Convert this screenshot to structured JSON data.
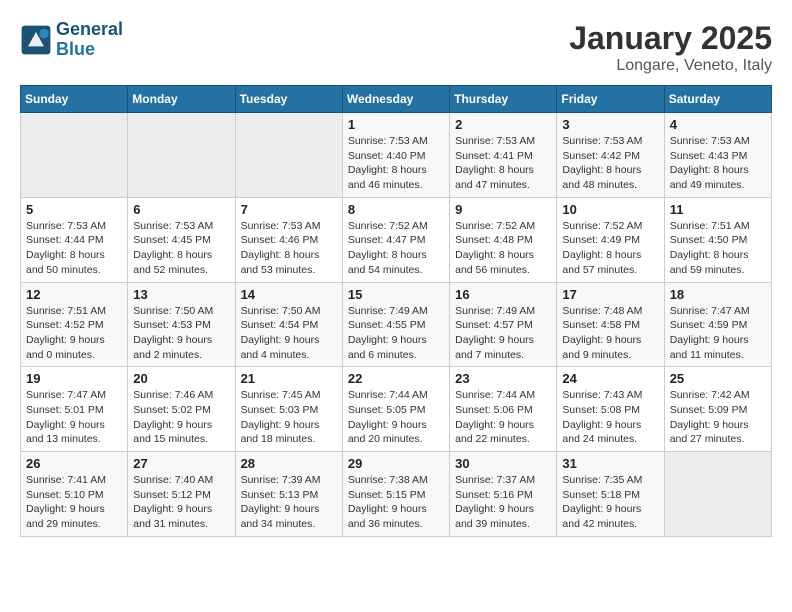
{
  "header": {
    "logo_line1": "General",
    "logo_line2": "Blue",
    "title": "January 2025",
    "subtitle": "Longare, Veneto, Italy"
  },
  "weekdays": [
    "Sunday",
    "Monday",
    "Tuesday",
    "Wednesday",
    "Thursday",
    "Friday",
    "Saturday"
  ],
  "weeks": [
    [
      {
        "day": "",
        "info": ""
      },
      {
        "day": "",
        "info": ""
      },
      {
        "day": "",
        "info": ""
      },
      {
        "day": "1",
        "info": "Sunrise: 7:53 AM\nSunset: 4:40 PM\nDaylight: 8 hours and 46 minutes."
      },
      {
        "day": "2",
        "info": "Sunrise: 7:53 AM\nSunset: 4:41 PM\nDaylight: 8 hours and 47 minutes."
      },
      {
        "day": "3",
        "info": "Sunrise: 7:53 AM\nSunset: 4:42 PM\nDaylight: 8 hours and 48 minutes."
      },
      {
        "day": "4",
        "info": "Sunrise: 7:53 AM\nSunset: 4:43 PM\nDaylight: 8 hours and 49 minutes."
      }
    ],
    [
      {
        "day": "5",
        "info": "Sunrise: 7:53 AM\nSunset: 4:44 PM\nDaylight: 8 hours and 50 minutes."
      },
      {
        "day": "6",
        "info": "Sunrise: 7:53 AM\nSunset: 4:45 PM\nDaylight: 8 hours and 52 minutes."
      },
      {
        "day": "7",
        "info": "Sunrise: 7:53 AM\nSunset: 4:46 PM\nDaylight: 8 hours and 53 minutes."
      },
      {
        "day": "8",
        "info": "Sunrise: 7:52 AM\nSunset: 4:47 PM\nDaylight: 8 hours and 54 minutes."
      },
      {
        "day": "9",
        "info": "Sunrise: 7:52 AM\nSunset: 4:48 PM\nDaylight: 8 hours and 56 minutes."
      },
      {
        "day": "10",
        "info": "Sunrise: 7:52 AM\nSunset: 4:49 PM\nDaylight: 8 hours and 57 minutes."
      },
      {
        "day": "11",
        "info": "Sunrise: 7:51 AM\nSunset: 4:50 PM\nDaylight: 8 hours and 59 minutes."
      }
    ],
    [
      {
        "day": "12",
        "info": "Sunrise: 7:51 AM\nSunset: 4:52 PM\nDaylight: 9 hours and 0 minutes."
      },
      {
        "day": "13",
        "info": "Sunrise: 7:50 AM\nSunset: 4:53 PM\nDaylight: 9 hours and 2 minutes."
      },
      {
        "day": "14",
        "info": "Sunrise: 7:50 AM\nSunset: 4:54 PM\nDaylight: 9 hours and 4 minutes."
      },
      {
        "day": "15",
        "info": "Sunrise: 7:49 AM\nSunset: 4:55 PM\nDaylight: 9 hours and 6 minutes."
      },
      {
        "day": "16",
        "info": "Sunrise: 7:49 AM\nSunset: 4:57 PM\nDaylight: 9 hours and 7 minutes."
      },
      {
        "day": "17",
        "info": "Sunrise: 7:48 AM\nSunset: 4:58 PM\nDaylight: 9 hours and 9 minutes."
      },
      {
        "day": "18",
        "info": "Sunrise: 7:47 AM\nSunset: 4:59 PM\nDaylight: 9 hours and 11 minutes."
      }
    ],
    [
      {
        "day": "19",
        "info": "Sunrise: 7:47 AM\nSunset: 5:01 PM\nDaylight: 9 hours and 13 minutes."
      },
      {
        "day": "20",
        "info": "Sunrise: 7:46 AM\nSunset: 5:02 PM\nDaylight: 9 hours and 15 minutes."
      },
      {
        "day": "21",
        "info": "Sunrise: 7:45 AM\nSunset: 5:03 PM\nDaylight: 9 hours and 18 minutes."
      },
      {
        "day": "22",
        "info": "Sunrise: 7:44 AM\nSunset: 5:05 PM\nDaylight: 9 hours and 20 minutes."
      },
      {
        "day": "23",
        "info": "Sunrise: 7:44 AM\nSunset: 5:06 PM\nDaylight: 9 hours and 22 minutes."
      },
      {
        "day": "24",
        "info": "Sunrise: 7:43 AM\nSunset: 5:08 PM\nDaylight: 9 hours and 24 minutes."
      },
      {
        "day": "25",
        "info": "Sunrise: 7:42 AM\nSunset: 5:09 PM\nDaylight: 9 hours and 27 minutes."
      }
    ],
    [
      {
        "day": "26",
        "info": "Sunrise: 7:41 AM\nSunset: 5:10 PM\nDaylight: 9 hours and 29 minutes."
      },
      {
        "day": "27",
        "info": "Sunrise: 7:40 AM\nSunset: 5:12 PM\nDaylight: 9 hours and 31 minutes."
      },
      {
        "day": "28",
        "info": "Sunrise: 7:39 AM\nSunset: 5:13 PM\nDaylight: 9 hours and 34 minutes."
      },
      {
        "day": "29",
        "info": "Sunrise: 7:38 AM\nSunset: 5:15 PM\nDaylight: 9 hours and 36 minutes."
      },
      {
        "day": "30",
        "info": "Sunrise: 7:37 AM\nSunset: 5:16 PM\nDaylight: 9 hours and 39 minutes."
      },
      {
        "day": "31",
        "info": "Sunrise: 7:35 AM\nSunset: 5:18 PM\nDaylight: 9 hours and 42 minutes."
      },
      {
        "day": "",
        "info": ""
      }
    ]
  ]
}
